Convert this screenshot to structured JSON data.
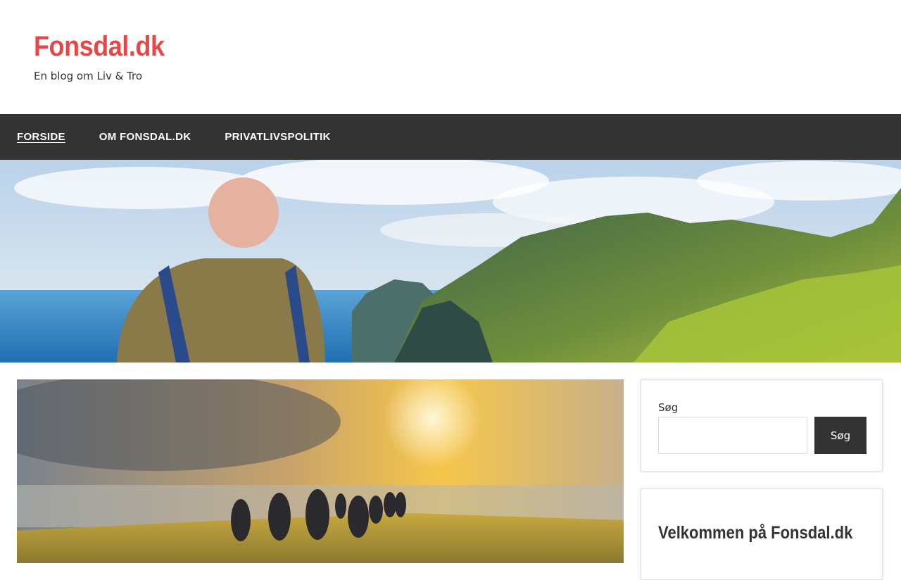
{
  "site": {
    "title": "Fonsdal.dk",
    "description": "En blog om Liv & Tro"
  },
  "nav": {
    "items": [
      {
        "label": "FORSIDE",
        "current": true
      },
      {
        "label": "OM FONSDAL.DK",
        "current": false
      },
      {
        "label": "PRIVATLIVSPOLITIK",
        "current": false
      }
    ]
  },
  "sidebar": {
    "search": {
      "label": "Søg",
      "input_value": "",
      "button_label": "Søg"
    },
    "welcome": {
      "title": "Velkommen på Fonsdal.dk"
    }
  },
  "colors": {
    "title": "#e84747",
    "nav_background": "#333333",
    "text": "#333333"
  }
}
